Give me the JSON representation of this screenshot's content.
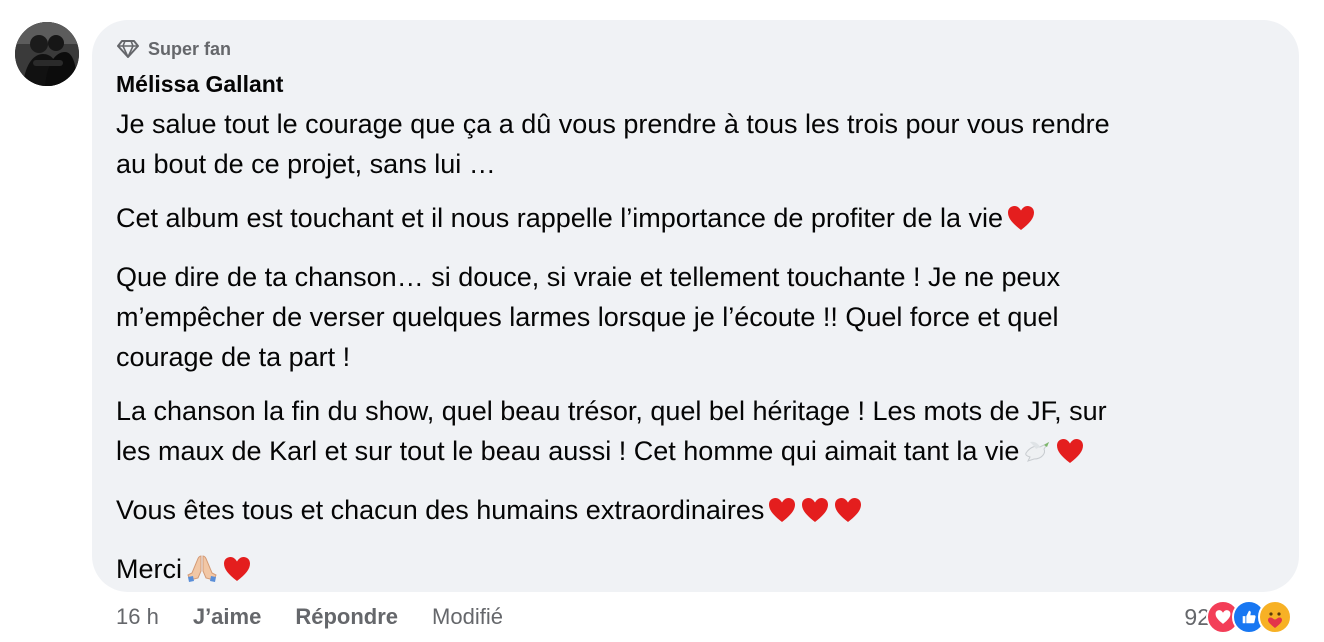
{
  "comment": {
    "avatar_alt": "avatar",
    "badge": {
      "icon": "diamond-icon",
      "label": "Super fan"
    },
    "author": "Mélissa Gallant",
    "paragraphs": [
      {
        "lines": [
          "Je salue tout le courage que ça a dû vous prendre à tous les trois pour vous rendre",
          "au bout de ce projet, sans lui …"
        ]
      },
      {
        "lines": [
          "Cet album est touchant et il nous rappelle l’importance de profiter de la vie"
        ],
        "emoji": [
          "red-heart-emoji"
        ]
      },
      {
        "lines": [
          "Que dire de ta chanson… si douce, si vraie et tellement touchante ! Je ne peux",
          "m’empêcher de verser quelques larmes lorsque je l’écoute !! Quel force et quel",
          "courage de ta part !"
        ]
      },
      {
        "lines": [
          "La chanson la fin du show, quel beau trésor, quel bel héritage ! Les mots de JF, sur",
          "les maux de Karl et sur tout le beau aussi ! Cet homme qui aimait tant la vie"
        ],
        "emoji": [
          "dove-emoji",
          "red-heart-emoji"
        ]
      },
      {
        "lines": [
          "Vous êtes tous et chacun des humains extraordinaires"
        ],
        "emoji": [
          "red-heart-emoji",
          "red-heart-emoji",
          "red-heart-emoji"
        ]
      },
      {
        "lines": [
          "Merci"
        ],
        "emoji": [
          "folded-hands-emoji",
          "red-heart-emoji"
        ]
      }
    ]
  },
  "actions": {
    "time": "16 h",
    "like": "J’aime",
    "reply": "Répondre",
    "edited": "Modifié"
  },
  "reactions": {
    "count": "92",
    "icons": [
      "love-reaction-icon",
      "like-reaction-icon",
      "care-reaction-icon"
    ],
    "colors": {
      "love": "#f33e58",
      "like": "#1877f2",
      "care": "#f7b125"
    }
  }
}
